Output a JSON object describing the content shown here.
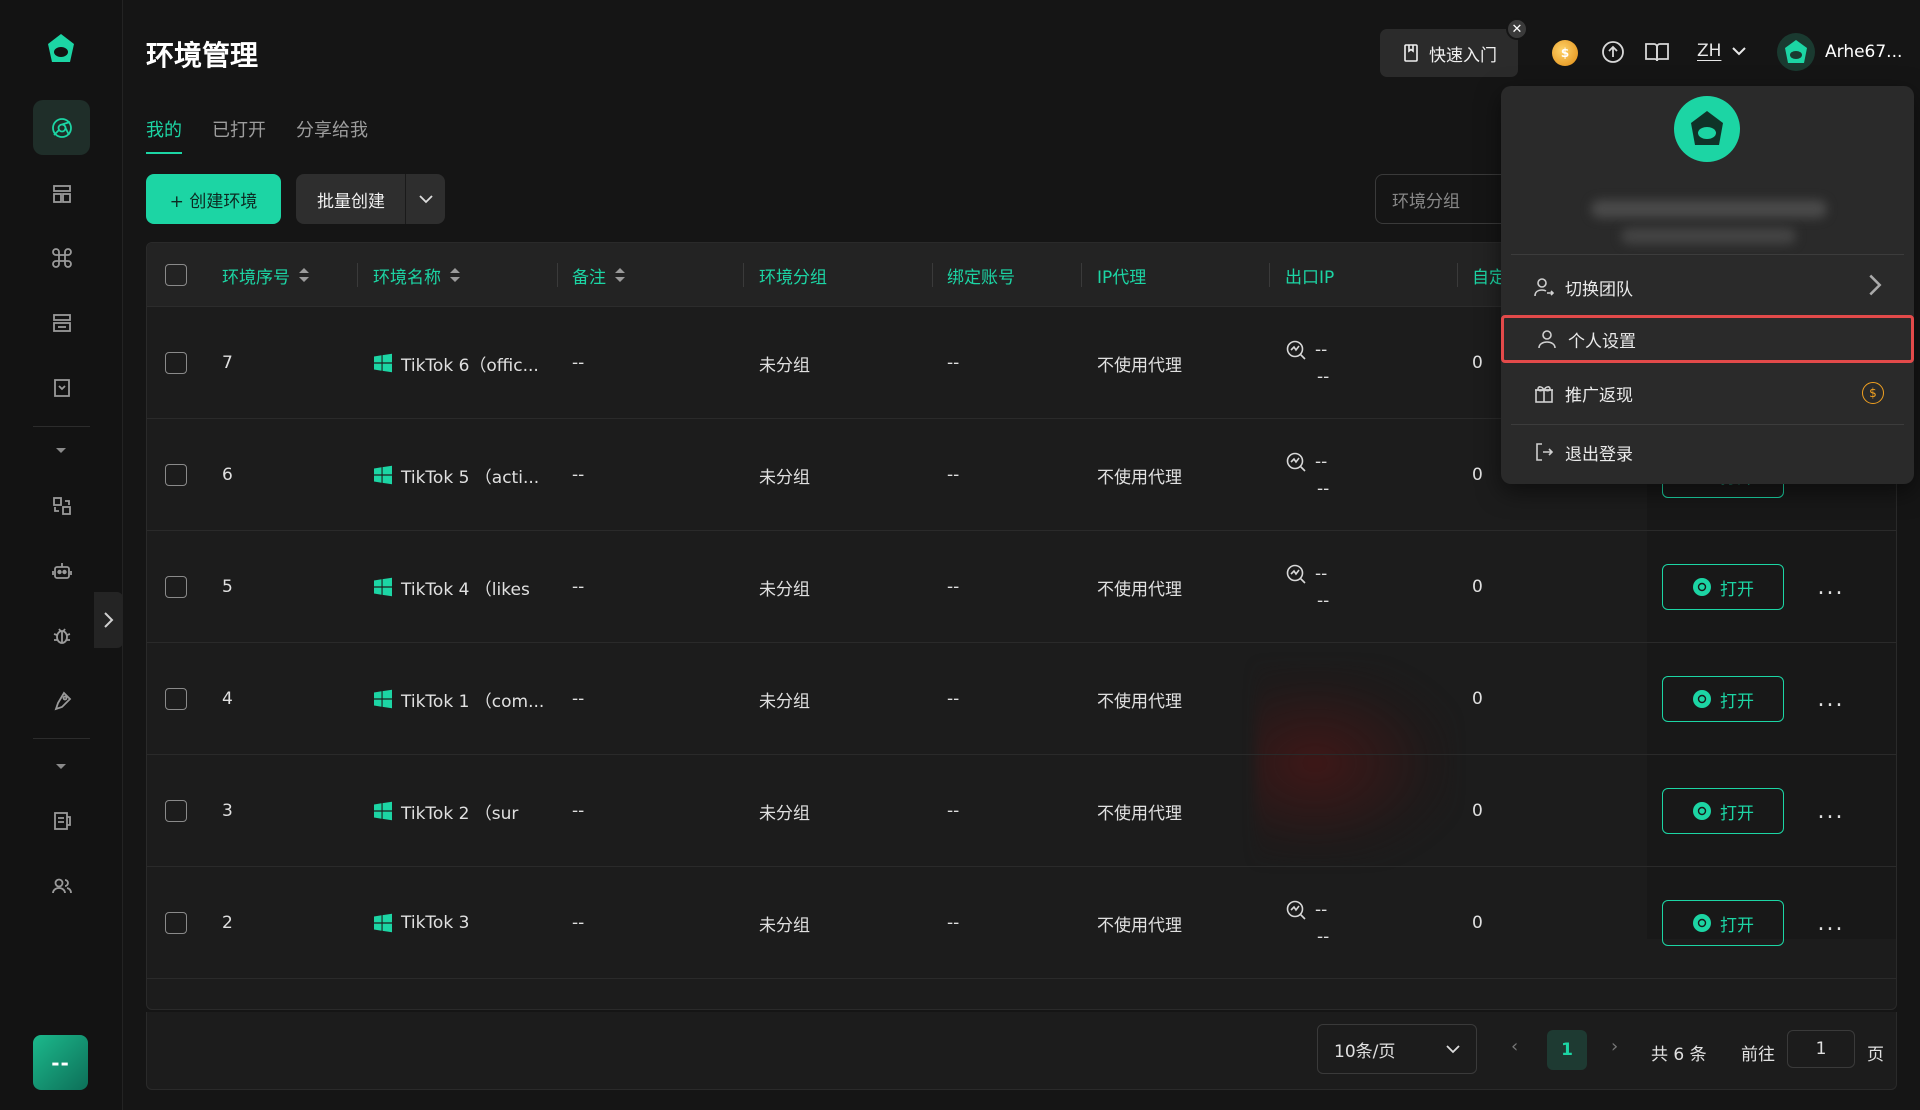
{
  "page": {
    "title": "环境管理"
  },
  "sidebar": {
    "bottom_label": "--"
  },
  "header": {
    "quick_start": "快速入门",
    "lang": "ZH",
    "user_name": "Arhe67..."
  },
  "tabs": [
    {
      "label": "我的",
      "active": true
    },
    {
      "label": "已打开",
      "active": false
    },
    {
      "label": "分享给我",
      "active": false
    }
  ],
  "toolbar": {
    "create_label": "+ 创建环境",
    "batch_label": "批量创建",
    "group_filter_placeholder": "环境分组"
  },
  "table": {
    "columns": [
      "环境序号",
      "环境名称",
      "备注",
      "环境分组",
      "绑定账号",
      "IP代理",
      "出口IP",
      "自定"
    ],
    "rows": [
      {
        "id": "7",
        "name": "TikTok 6（offic...",
        "note": "--",
        "group": "未分组",
        "account": "--",
        "proxy": "不使用代理",
        "ip1": "--",
        "ip2": "--",
        "custom": "0"
      },
      {
        "id": "6",
        "name": "TikTok 5 （acti...",
        "note": "--",
        "group": "未分组",
        "account": "--",
        "proxy": "不使用代理",
        "ip1": "--",
        "ip2": "--",
        "custom": "0"
      },
      {
        "id": "5",
        "name": "TikTok 4 （likes",
        "note": "--",
        "group": "未分组",
        "account": "--",
        "proxy": "不使用代理",
        "ip1": "--",
        "ip2": "--",
        "custom": "0"
      },
      {
        "id": "4",
        "name": "TikTok 1 （com...",
        "note": "--",
        "group": "未分组",
        "account": "--",
        "proxy": "不使用代理",
        "ip1": "",
        "ip2": "",
        "custom": "0"
      },
      {
        "id": "3",
        "name": "TikTok 2 （sur",
        "note": "--",
        "group": "未分组",
        "account": "--",
        "proxy": "不使用代理",
        "ip1": "",
        "ip2": "",
        "custom": "0"
      },
      {
        "id": "2",
        "name": "TikTok 3",
        "note": "--",
        "group": "未分组",
        "account": "--",
        "proxy": "不使用代理",
        "ip1": "--",
        "ip2": "--",
        "custom": "0"
      }
    ],
    "open_label": "打开",
    "more_label": "..."
  },
  "pagination": {
    "page_size": "10条/页",
    "current_page": "1",
    "total": "共 6 条",
    "goto_label": "前往",
    "goto_value": "1",
    "page_suffix": "页"
  },
  "dropdown": {
    "switch_team": "切换团队",
    "personal_settings": "个人设置",
    "referral": "推广返现",
    "logout": "退出登录"
  },
  "colors": {
    "accent": "#1cd5a4",
    "highlight_border": "#e34a4a",
    "background": "#151515"
  }
}
